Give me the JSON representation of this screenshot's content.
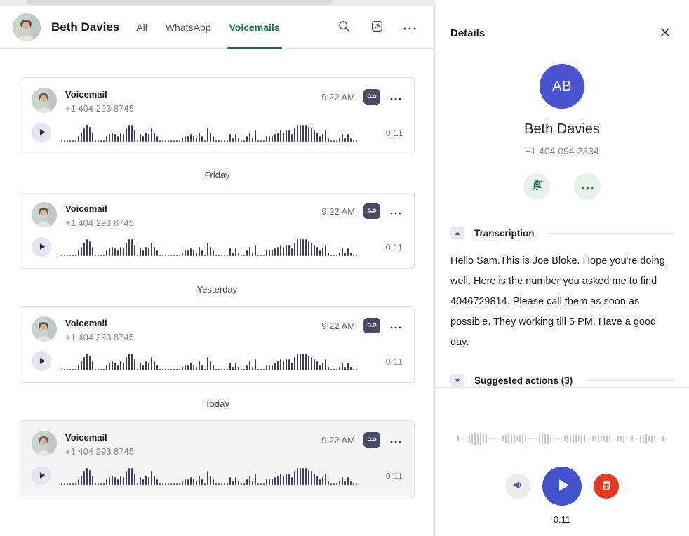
{
  "header": {
    "title": "Beth Davies",
    "tabs": [
      {
        "label": "All",
        "active": false
      },
      {
        "label": "WhatsApp",
        "active": false
      },
      {
        "label": "Voicemails",
        "active": true
      }
    ],
    "icons": {
      "search": "search-icon",
      "popout": "open-in-new-icon",
      "more": "ellipsis-icon"
    }
  },
  "list": {
    "waveform": "1111113579851111345435479961435475311111111233432531753111114242113526111333456566479999876534621112424211",
    "groups": [
      {
        "date": "",
        "item": {
          "title": "Voicemail",
          "number": "+1 404 293 8745",
          "time": "9:22 AM",
          "duration": "0:11",
          "selected": false
        }
      },
      {
        "date": "Friday",
        "item": {
          "title": "Voicemail",
          "number": "+1 404 293 8745",
          "time": "9:22 AM",
          "duration": "0:11",
          "selected": false
        }
      },
      {
        "date": "Yesterday",
        "item": {
          "title": "Voicemail",
          "number": "+1 404 293 8745",
          "time": "9:22 AM",
          "duration": "0:11",
          "selected": false
        }
      },
      {
        "date": "Today",
        "item": {
          "title": "Voicemail",
          "number": "+1 404 293 8745",
          "time": "9:22 AM",
          "duration": "0:11",
          "selected": true
        }
      }
    ],
    "item_icons": {
      "badge": "voicemail-icon",
      "play": "play-icon",
      "more": "ellipsis-icon"
    }
  },
  "details": {
    "heading": "Details",
    "close": "close-icon",
    "contact": {
      "initials": "AB",
      "name": "Beth Davies",
      "phone": "+1 404 094 2334",
      "action_icons": {
        "mute": "bell-off-icon",
        "more": "ellipsis-icon"
      }
    },
    "transcription": {
      "label": "Transcription",
      "text": "Hello Sam.This is Joe Bloke. Hope you're doing well. Here is the number you asked me to find 4046729814. Please call them as soon as possible. They working till 5 PM. Have a good day."
    },
    "suggested": {
      "label": "Suggested actions (3)"
    },
    "player": {
      "duration": "0:11",
      "waveform": "211134545431111123443234211113444311112334324311223223211223112113342321121",
      "icons": {
        "volume": "speaker-icon",
        "play": "play-icon",
        "delete": "trash-icon"
      }
    }
  },
  "colors": {
    "accent_green": "#107C41",
    "indigo": "#4A53D0",
    "badge_indigo": "#4A4A66",
    "wave_dark": "#3E3E5F",
    "wave_gray": "#C7C7CC",
    "red": "#E6381F",
    "mint_bg": "#E9F1ED",
    "icon_green": "#2D7C49"
  }
}
